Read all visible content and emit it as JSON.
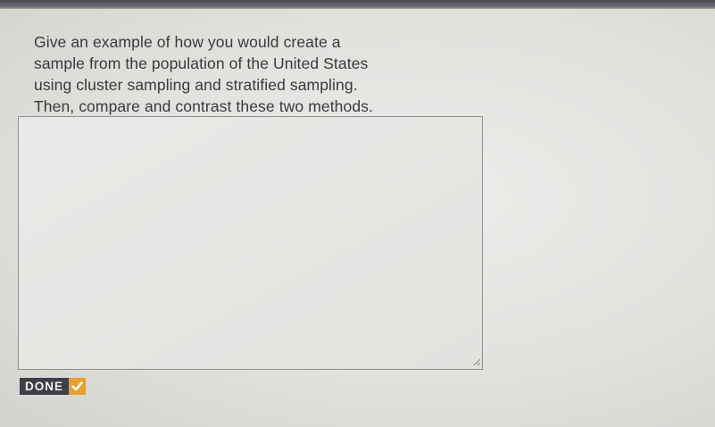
{
  "question": {
    "text": "Give an example of how you would create a\nsample from the population of the United States\nusing cluster sampling and stratified sampling.\nThen, compare and contrast these two methods."
  },
  "answer": {
    "value": "",
    "placeholder": ""
  },
  "done_button": {
    "label": "DONE",
    "icon": "checkmark-icon",
    "check_color": "#e8a02a",
    "label_bg": "#3d3f44"
  }
}
